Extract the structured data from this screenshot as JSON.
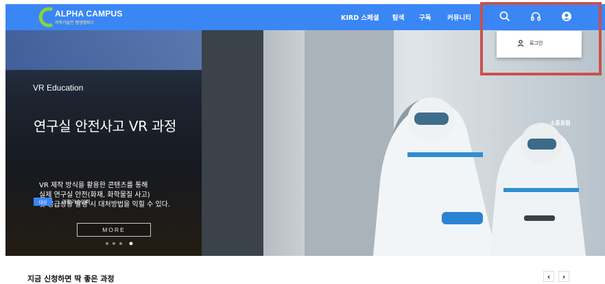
{
  "header": {
    "logo_title": "ALPHA CAMPUS",
    "logo_subtitle": "과학기술인 평생캠퍼스",
    "nav": [
      "KIRD 스페셜",
      "탐색",
      "구독",
      "커뮤니티"
    ],
    "icons": [
      "search-icon",
      "headset-icon",
      "user-circle-icon"
    ],
    "colors": {
      "header_bg": "#3a86f5",
      "highlight_border": "#c9504f"
    }
  },
  "dropdown": {
    "login_label": "로그인"
  },
  "hero": {
    "tag": "VR Education",
    "title": "연구실 안전사고 VR 과정",
    "description": [
      "VR 제작 방식을 활용한 콘텐츠를 통해",
      "실제 연구실 안전(화재, 화학물질 사고)",
      "및 응급상황 발생 시 대처방법을 익힐 수 있다."
    ],
    "target_label": "대상",
    "target_value": "과학기술인력",
    "more_label": "MORE",
    "side_text": "소통포럼"
  },
  "section": {
    "title": "지금 신청하면 딱 좋은 과정"
  }
}
